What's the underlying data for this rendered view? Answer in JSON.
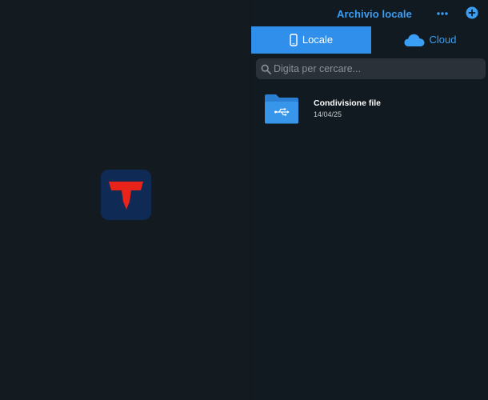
{
  "colors": {
    "accent": "#3a9ef5",
    "active_tab_bg": "#2f8fea",
    "background": "#141c22",
    "logo_bg": "#0f2a55",
    "logo_red": "#e8231a"
  },
  "nav": {
    "title": "Archivio locale",
    "more_icon": "ellipsis-icon",
    "add_icon": "plus-circle-icon"
  },
  "tabs": [
    {
      "label": "Locale",
      "icon": "phone-icon",
      "active": true
    },
    {
      "label": "Cloud",
      "icon": "cloud-icon",
      "active": false
    }
  ],
  "search": {
    "placeholder": "Digita per cercare...",
    "value": ""
  },
  "files": [
    {
      "name": "Condivisione file",
      "date": "14/04/25",
      "icon": "usb-folder-icon"
    }
  ]
}
